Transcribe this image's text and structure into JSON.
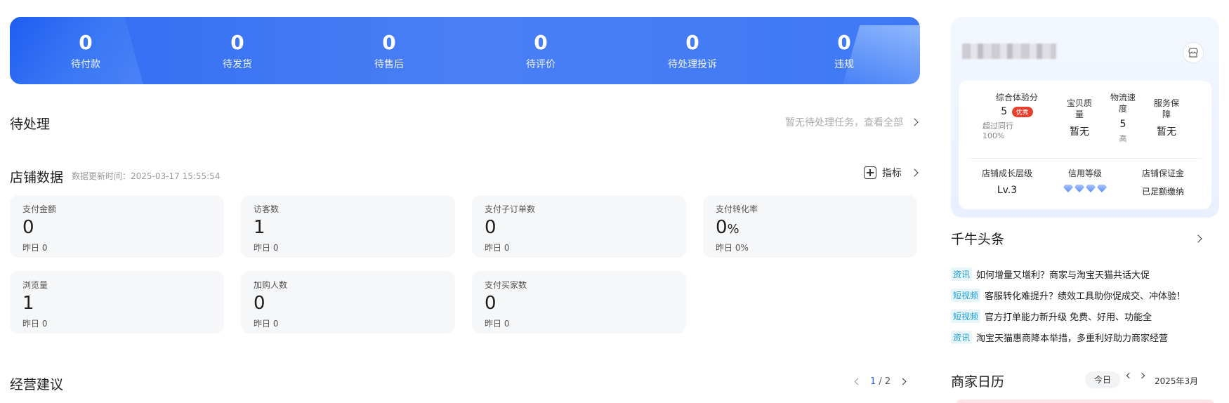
{
  "orders": [
    {
      "count": "0",
      "label": "待付款"
    },
    {
      "count": "0",
      "label": "待发货"
    },
    {
      "count": "0",
      "label": "待售后"
    },
    {
      "count": "0",
      "label": "待评价"
    },
    {
      "count": "0",
      "label": "待处理投诉"
    },
    {
      "count": "0",
      "label": "违规"
    }
  ],
  "pending": {
    "title": "待处理",
    "link": "暂无待处理任务，查看全部"
  },
  "store_data": {
    "title": "店铺数据",
    "update_time": "数据更新时间：2025-03-17 15:55:54",
    "metric_link": "指标",
    "cards": [
      {
        "label": "支付金额",
        "value": "0",
        "unit": "",
        "prev": "昨日 0"
      },
      {
        "label": "访客数",
        "value": "1",
        "unit": "",
        "prev": "昨日 0"
      },
      {
        "label": "支付子订单数",
        "value": "0",
        "unit": "",
        "prev": "昨日 0"
      },
      {
        "label": "支付转化率",
        "value": "0",
        "unit": "%",
        "prev": "昨日 0%"
      },
      {
        "label": "浏览量",
        "value": "1",
        "unit": "",
        "prev": "昨日 0"
      },
      {
        "label": "加购人数",
        "value": "0",
        "unit": "",
        "prev": "昨日 0"
      },
      {
        "label": "支付买家数",
        "value": "0",
        "unit": "",
        "prev": "昨日 0"
      }
    ]
  },
  "advice": {
    "title": "经营建议",
    "page_current": "1",
    "page_total": "/ 2"
  },
  "shop": {
    "experience_label": "综合体验分",
    "experience_score": "5",
    "experience_badge": "优秀",
    "peer_text": "超过同行",
    "peer_value": "100%",
    "quality_label": "宝贝质量",
    "quality_value": "暂无",
    "logistics_label": "物流速度",
    "logistics_value": "5",
    "logistics_level": "高",
    "service_label": "服务保障",
    "service_value": "暂无",
    "growth_label": "店铺成长层级",
    "growth_value": "Lv.3",
    "credit_label": "信用等级",
    "deposit_label": "店铺保证金",
    "deposit_value": "已足额缴纳"
  },
  "news": {
    "title": "千牛头条",
    "items": [
      {
        "tag": "资讯",
        "text": "如何增量又增利？商家与淘宝天猫共话大促"
      },
      {
        "tag": "短视频",
        "text": "客服转化难提升？绩效工具助你促成交、冲体验！"
      },
      {
        "tag": "短视频",
        "text": "官方打单能力新升级 免费、好用、功能全"
      },
      {
        "tag": "资讯",
        "text": "淘宝天猫惠商降本举措，多重利好助力商家经营"
      }
    ]
  },
  "calendar": {
    "title": "商家日历",
    "today": "今日",
    "month": "2025年3月"
  },
  "colors": {
    "banner_blue": "#3f79f6",
    "accent_blue": "#2f6cf3",
    "badge_red": "#e9412f",
    "deposit_green": "#1fb860"
  }
}
